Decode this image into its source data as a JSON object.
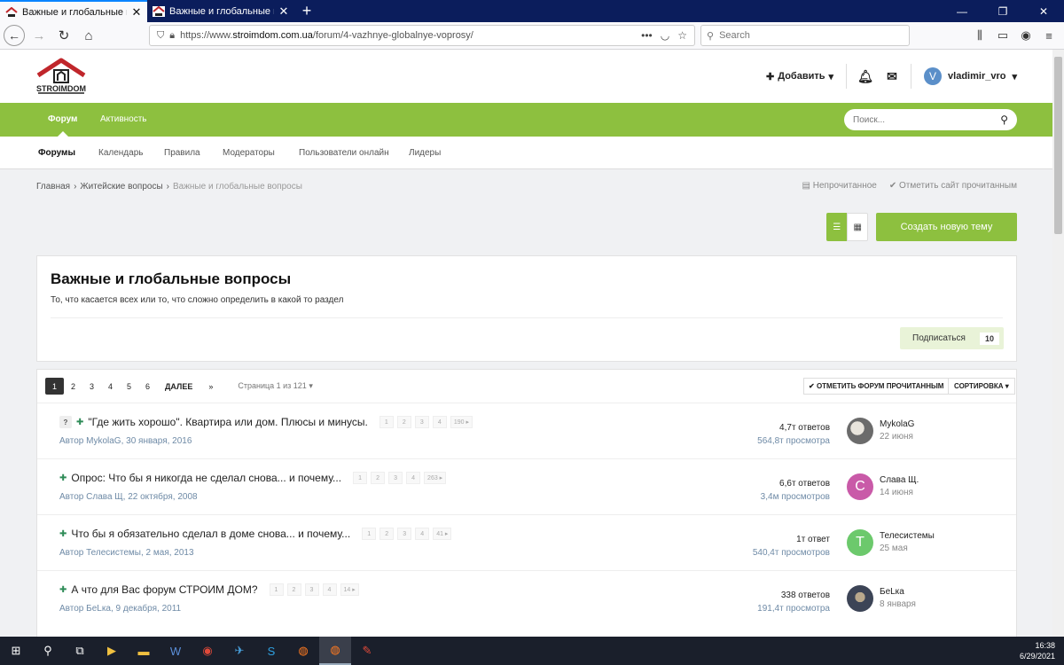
{
  "browser": {
    "tabs": [
      {
        "title": "Важные и глобальные вопросы",
        "active": true
      },
      {
        "title": "Важные и глобальные вопросы",
        "active": false
      }
    ],
    "url_prefix": "https://www.",
    "url_domain": "stroimdom.com.ua",
    "url_path": "/forum/4-vazhnye-globalnye-voprosy/",
    "search_placeholder": "Search"
  },
  "site": {
    "logo_text": "STROIMDOM",
    "add_label": "Добавить",
    "username": "vladimir_vro",
    "user_initial": "V"
  },
  "mainnav": {
    "tabs": [
      {
        "label": "Форум",
        "active": true
      },
      {
        "label": "Активность",
        "active": false
      }
    ],
    "search_placeholder": "Поиск..."
  },
  "subnav": {
    "items": [
      "Форумы",
      "Календарь",
      "Правила",
      "Модераторы",
      "Пользователи онлайн",
      "Лидеры"
    ]
  },
  "breadcrumb": {
    "items": [
      "Главная",
      "Житейские вопросы",
      "Важные и глобальные вопросы"
    ],
    "unread_label": "Непрочитанное",
    "mark_site_read_label": "Отметить сайт прочитанным"
  },
  "create_topic_label": "Создать новую тему",
  "forum": {
    "title": "Важные и глобальные вопросы",
    "description": "То, что касается всех или то, что сложно определить в какой то раздел",
    "follow_label": "Подписаться",
    "follow_count": "10"
  },
  "pagination": {
    "pages": [
      "1",
      "2",
      "3",
      "4",
      "5",
      "6"
    ],
    "next_label": "ДАЛЕЕ",
    "last_label": "»",
    "info": "Страница 1 из 121"
  },
  "mark_forum_read_label": "ОТМЕТИТЬ ФОРУМ ПРОЧИТАННЫМ",
  "sort_label": "СОРТИРОВКА",
  "topics": [
    {
      "has_q": true,
      "q_label": "?",
      "title": "\"Где жить хорошо\". Квартира или дом. Плюсы и минусы.",
      "mini_pages": [
        "1",
        "2",
        "3",
        "4",
        "190"
      ],
      "meta": "Автор MykolaG, 30 января, 2016",
      "replies": "4,7т ответов",
      "views": "564,8т просмотра",
      "last_user": "MykolaG",
      "last_date": "22 июня",
      "avatar_letter": "",
      "avatar_color": ""
    },
    {
      "has_q": false,
      "q_label": "",
      "title": "Опрос: Что бы я никогда не сделал снова... и почему...",
      "mini_pages": [
        "1",
        "2",
        "3",
        "4",
        "263"
      ],
      "meta": "Автор Слава Щ, 22 октября, 2008",
      "replies": "6,6т ответов",
      "views": "3,4м просмотров",
      "last_user": "Слава Щ.",
      "last_date": "14 июня",
      "avatar_letter": "С",
      "avatar_color": "#c95aa8"
    },
    {
      "has_q": false,
      "q_label": "",
      "title": "Что бы я обязательно сделал в доме снова... и почему...",
      "mini_pages": [
        "1",
        "2",
        "3",
        "4",
        "41"
      ],
      "meta": "Автор Телесистемы, 2 мая, 2013",
      "replies": "1т ответ",
      "views": "540,4т просмотров",
      "last_user": "Телесистемы",
      "last_date": "25 мая",
      "avatar_letter": "Т",
      "avatar_color": "#6cc96c"
    },
    {
      "has_q": false,
      "q_label": "",
      "title": "А что для Вас форум СТРОИМ ДОМ?",
      "mini_pages": [
        "1",
        "2",
        "3",
        "4",
        "14"
      ],
      "meta": "Автор БеLка, 9 декабря, 2011",
      "replies": "338 ответов",
      "views": "191,4т просмотра",
      "last_user": "БеLка",
      "last_date": "8 января",
      "avatar_letter": "",
      "avatar_color": ""
    }
  ],
  "clock": {
    "time": "16:38",
    "date": "6/29/2021"
  },
  "colors": {
    "accent": "#8dc03f",
    "tab_bar": "#0b1d5c"
  }
}
